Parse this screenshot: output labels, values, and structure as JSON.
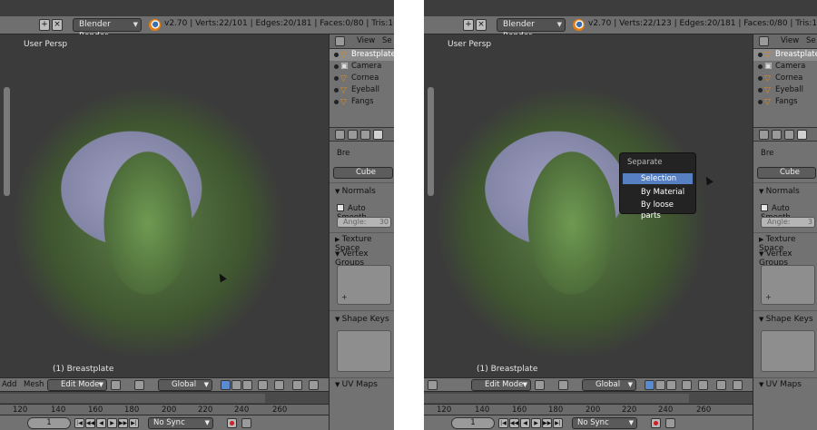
{
  "left": {
    "render_engine": "Blender Render",
    "stats": "v2.70 | Verts:22/101 | Edges:20/181 | Faces:0/80 | Tris:160 | Mem:158.26M",
    "viewport_label": "User Persp",
    "object_label": "(1) Breastplate",
    "menu_items": [
      "Add",
      "Mesh"
    ],
    "mode": "Edit Mode",
    "orientation": "Global",
    "frame_ticks": [
      "120",
      "140",
      "160",
      "180",
      "200",
      "220",
      "240",
      "260"
    ],
    "current_frame": "1",
    "sync": "No Sync"
  },
  "right": {
    "render_engine": "Blender Render",
    "stats": "v2.70 | Verts:22/123 | Edges:20/181 | Faces:0/80 | Tris:160 | Mem:158.32M",
    "viewport_label": "User Persp",
    "object_label": "(1) Breastplate",
    "mode": "Edit Mode",
    "orientation": "Global",
    "frame_ticks": [
      "120",
      "140",
      "160",
      "180",
      "200",
      "220",
      "240",
      "260"
    ],
    "current_frame": "1",
    "sync": "No Sync",
    "popup": {
      "title": "Separate",
      "items": [
        "Selection",
        "By Material",
        "By loose parts"
      ]
    }
  },
  "side_left": {
    "outliner_view": "View",
    "outliner_extra": "Se",
    "objects": [
      "Breastplate",
      "Camera",
      "Cornea",
      "Eyeball",
      "Fangs"
    ],
    "crumb": "Bre",
    "mesh_name": "Cube",
    "sections": {
      "normals": "Normals",
      "auto_smooth": "Auto Smooth",
      "angle": "Angle:",
      "angle_value": "30",
      "texture_space": "Texture Space",
      "vertex_groups": "Vertex Groups",
      "shape_keys": "Shape Keys",
      "uv_maps": "UV Maps"
    }
  },
  "side_right": {
    "outliner_view": "View",
    "outliner_extra": "Se",
    "objects": [
      "Breastplate",
      "Camera",
      "Cornea",
      "Eyeball",
      "Fangs"
    ],
    "crumb": "Bre",
    "mesh_name": "Cube",
    "sections": {
      "normals": "Normals",
      "auto_smooth": "Auto Smooth",
      "angle": "Angle:",
      "angle_value": "3",
      "texture_space": "Texture Space",
      "vertex_groups": "Vertex Groups",
      "shape_keys": "Shape Keys",
      "uv_maps": "UV Maps"
    }
  },
  "colors": {
    "panel_bg": "#727272",
    "viewport_bg": "#3d3d3d",
    "highlight": "#5680c2",
    "object_icon": "#e08a1f"
  }
}
